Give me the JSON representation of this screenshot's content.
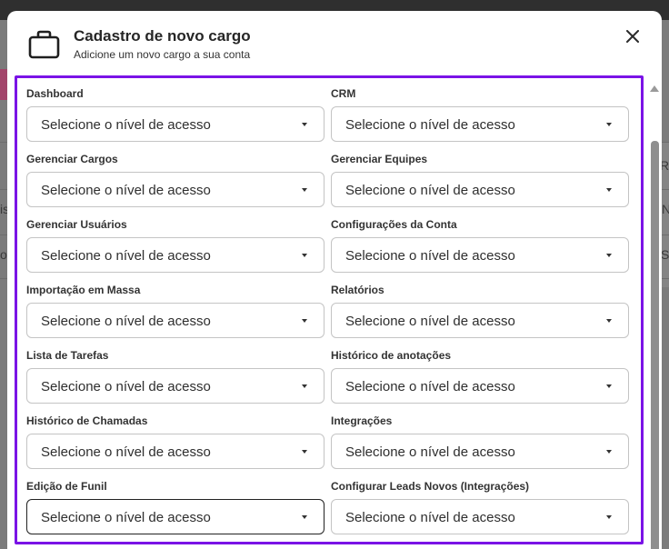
{
  "modal": {
    "title": "Cadastro de novo cargo",
    "subtitle": "Adicione um novo cargo a sua conta"
  },
  "background": {
    "fragments": [
      "Ro",
      "is",
      "N",
      "o",
      "Si"
    ]
  },
  "fields": [
    {
      "label": "Dashboard",
      "placeholder": "Selecione o nível de acesso"
    },
    {
      "label": "CRM",
      "placeholder": "Selecione o nível de acesso"
    },
    {
      "label": "Gerenciar Cargos",
      "placeholder": "Selecione o nível de acesso"
    },
    {
      "label": "Gerenciar Equipes",
      "placeholder": "Selecione o nível de acesso"
    },
    {
      "label": "Gerenciar Usuários",
      "placeholder": "Selecione o nível de acesso"
    },
    {
      "label": "Configurações da Conta",
      "placeholder": "Selecione o nível de acesso"
    },
    {
      "label": "Importação em Massa",
      "placeholder": "Selecione o nível de acesso"
    },
    {
      "label": "Relatórios",
      "placeholder": "Selecione o nível de acesso"
    },
    {
      "label": "Lista de Tarefas",
      "placeholder": "Selecione o nível de acesso"
    },
    {
      "label": "Histórico de anotações",
      "placeholder": "Selecione o nível de acesso"
    },
    {
      "label": "Histórico de Chamadas",
      "placeholder": "Selecione o nível de acesso"
    },
    {
      "label": "Integrações",
      "placeholder": "Selecione o nível de acesso"
    },
    {
      "label": "Edição de Funil",
      "placeholder": "Selecione o nível de acesso",
      "focused": true
    },
    {
      "label": "Configurar Leads Novos (Integrações)",
      "placeholder": "Selecione o nível de acesso"
    }
  ],
  "colors": {
    "accent_outline": "#7a13e6",
    "overlay": "#7b7b7b",
    "text": "#262626"
  },
  "icons": {
    "header": "briefcase-icon",
    "close": "close-icon",
    "select": "caret-down-icon"
  }
}
